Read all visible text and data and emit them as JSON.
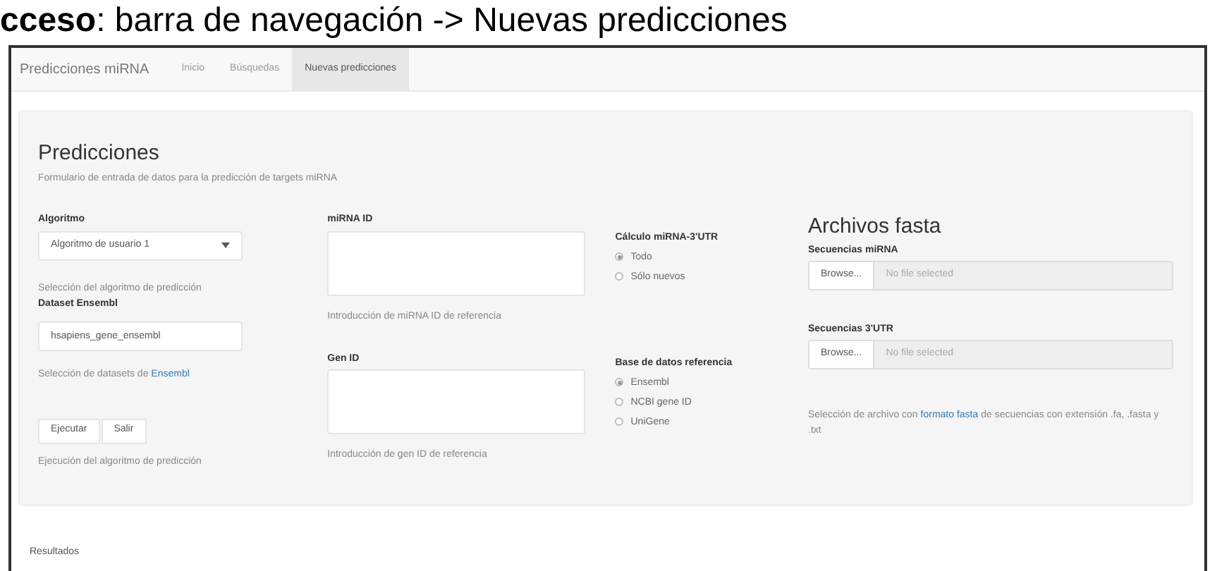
{
  "heading": "**cceso**: barra de navegación -> Nuevas predicciones",
  "navbar": {
    "brand": "Predicciones miRNA",
    "items": [
      {
        "label": "Inicio",
        "selected": false
      },
      {
        "label": "Búsquedas",
        "selected": false
      },
      {
        "label": "Nuevas predicciones",
        "selected": true
      }
    ]
  },
  "panel": {
    "title": "Predicciones",
    "subtitle": "Formulario de entrada de datos para la predicción de targets miRNA",
    "algorithm": {
      "label": "Algoritmo",
      "value": "Algoritmo de usuario 1",
      "help": "Selección del algoritmo de predicción"
    },
    "dataset": {
      "label": "Dataset Ensembl",
      "value": "hsapiens_gene_ensembl",
      "help": "Selección de datasets de ",
      "help_link": "Ensembl"
    },
    "buttons": [
      "Ejecutar",
      "Salir"
    ],
    "buttons_help": "Ejecución del algoritmo de predicción",
    "mirna_id": {
      "label": "miRNA ID",
      "help": "Introducción de miRNA ID de referencia"
    },
    "gen_id": {
      "label": "Gen ID",
      "help": "Introducción de gen ID de referencia"
    },
    "calculo": {
      "label": "Cálculo miRNA-3'UTR",
      "options": [
        {
          "label": "Todo",
          "selected": true
        },
        {
          "label": "Sólo nuevos",
          "selected": false
        }
      ]
    },
    "base_datos": {
      "label": "Base de datos referencia",
      "options": [
        {
          "label": "Ensembl",
          "selected": true
        },
        {
          "label": "NCBI gene ID",
          "selected": false
        },
        {
          "label": "UniGene",
          "selected": false
        }
      ]
    },
    "fasta": {
      "title": "Archivos fasta",
      "files": [
        {
          "label": "Secuencias miRNA",
          "button": "Browse...",
          "status": "No file selected"
        },
        {
          "label": "Secuencias 3'UTR",
          "button": "Browse...",
          "status": "No file selected"
        }
      ],
      "help_before": "Selección de archivo con ",
      "help_link": "formato fasta",
      "help_after": " de secuencias con extensión .fa, .fasta y .txt"
    }
  },
  "results_label": "Resultados"
}
